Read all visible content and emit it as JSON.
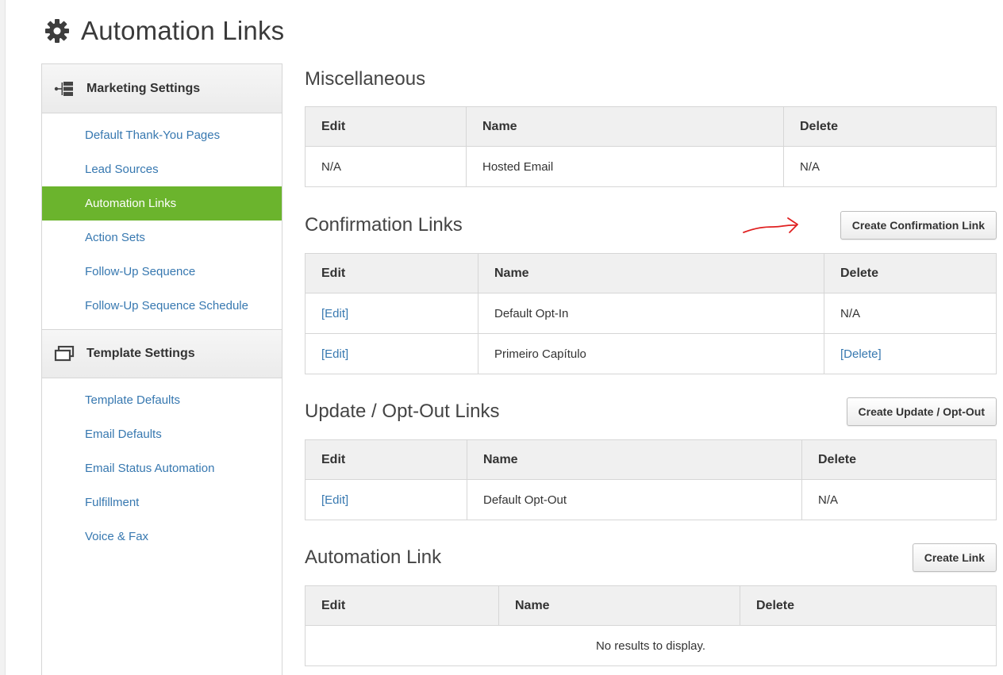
{
  "header": {
    "title": "Automation Links",
    "icon": "gear-icon"
  },
  "sidebar": {
    "sections": [
      {
        "heading": "Marketing Settings",
        "icon": "hierarchy-icon",
        "items": [
          {
            "label": "Default Thank-You Pages",
            "active": false
          },
          {
            "label": "Lead Sources",
            "active": false
          },
          {
            "label": "Automation Links",
            "active": true
          },
          {
            "label": "Action Sets",
            "active": false
          },
          {
            "label": "Follow-Up Sequence",
            "active": false
          },
          {
            "label": "Follow-Up Sequence Schedule",
            "active": false
          }
        ]
      },
      {
        "heading": "Template Settings",
        "icon": "windows-icon",
        "items": [
          {
            "label": "Template Defaults"
          },
          {
            "label": "Email Defaults"
          },
          {
            "label": "Email Status Automation"
          },
          {
            "label": "Fulfillment"
          },
          {
            "label": "Voice & Fax"
          }
        ]
      }
    ]
  },
  "main": {
    "miscellaneous": {
      "title": "Miscellaneous",
      "columns": [
        "Edit",
        "Name",
        "Delete"
      ],
      "rows": [
        [
          "N/A",
          "Hosted Email",
          "N/A"
        ]
      ]
    },
    "confirmation": {
      "title": "Confirmation Links",
      "button": "Create Confirmation Link",
      "columns": [
        "Edit",
        "Name",
        "Delete"
      ],
      "rows": [
        [
          "[Edit]",
          "Default Opt-In",
          "N/A"
        ],
        [
          "[Edit]",
          "Primeiro Capítulo",
          "[Delete]"
        ]
      ]
    },
    "update_optout": {
      "title": "Update / Opt-Out Links",
      "button": "Create Update / Opt-Out",
      "columns": [
        "Edit",
        "Name",
        "Delete"
      ],
      "rows": [
        [
          "[Edit]",
          "Default Opt-Out",
          "N/A"
        ]
      ]
    },
    "automation": {
      "title": "Automation Link",
      "button": "Create Link",
      "columns": [
        "Edit",
        "Name",
        "Delete"
      ],
      "empty_text": "No results to display."
    }
  },
  "colors": {
    "accent": "#6bb42d",
    "link": "#3778b0",
    "annotation": "#e02020"
  }
}
